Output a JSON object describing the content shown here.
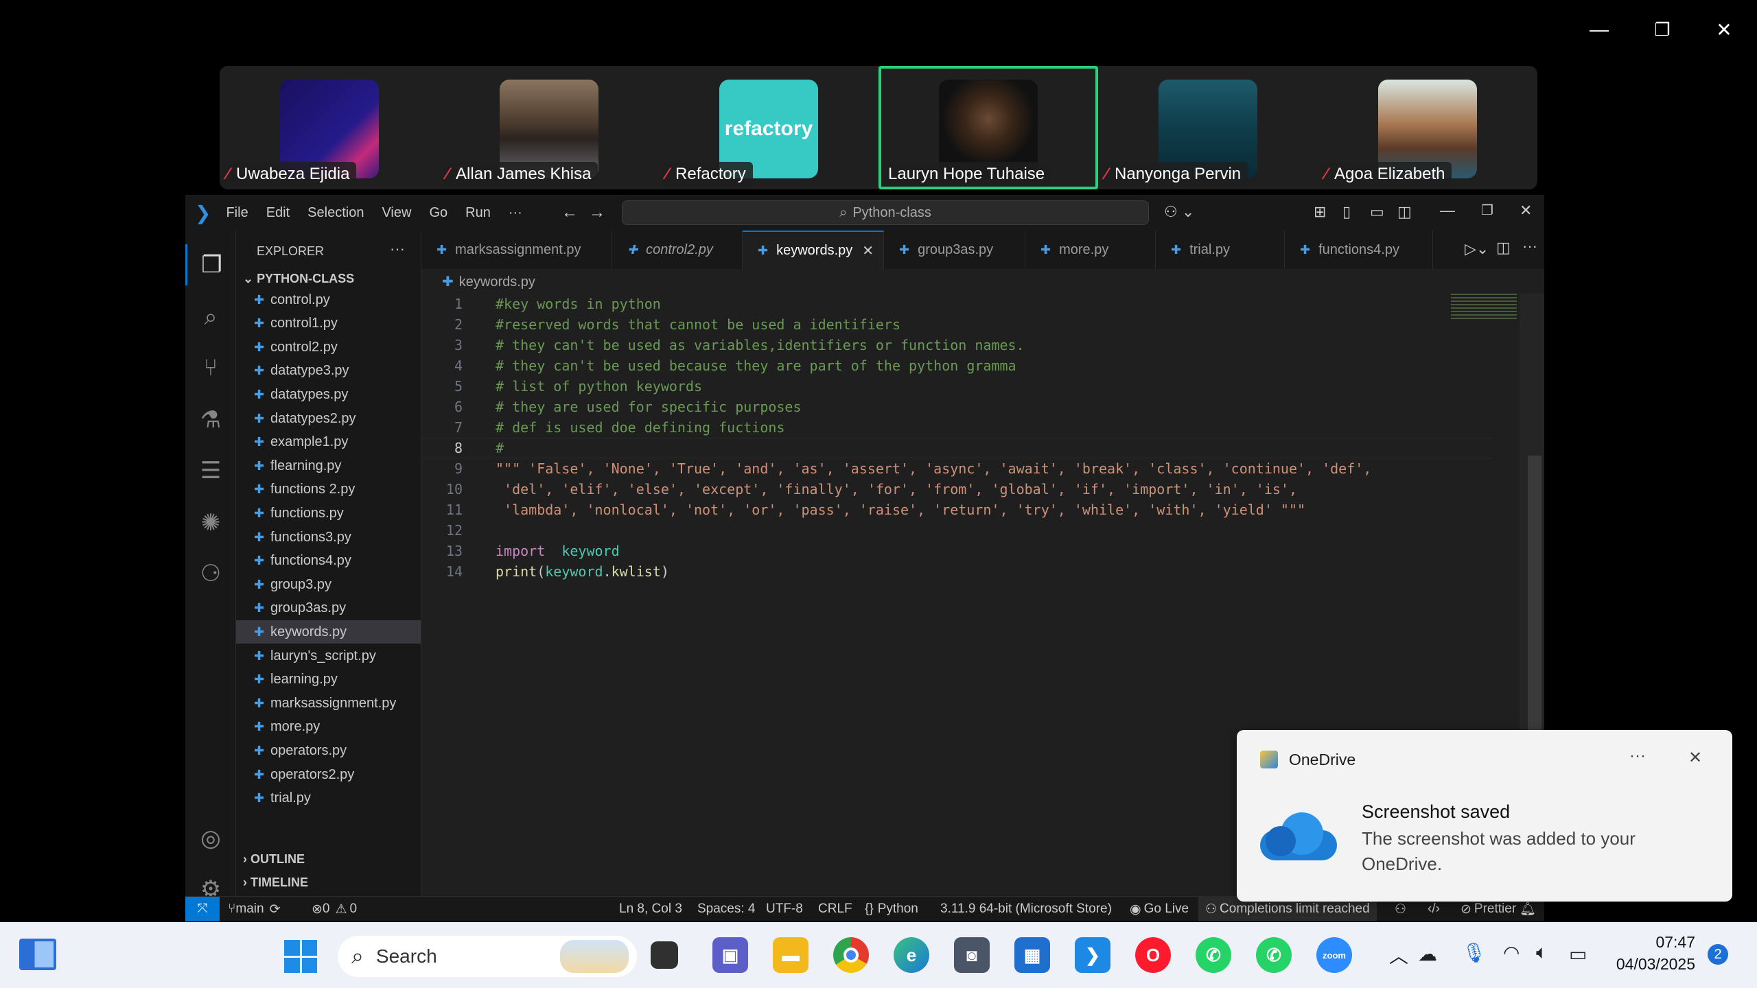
{
  "window_controls": {
    "minimize": "—",
    "restore": "❐",
    "close": "✕"
  },
  "participants": [
    {
      "name": "Uwabeza Ejidia",
      "active": false
    },
    {
      "name": "Allan James Khisa",
      "active": false
    },
    {
      "name": "Refactory",
      "active": false,
      "logo_text": "refactory"
    },
    {
      "name": "Lauryn Hope Tuhaise",
      "active": true
    },
    {
      "name": "Nanyonga Pervin",
      "active": false
    },
    {
      "name": "Agoa Elizabeth",
      "active": false
    }
  ],
  "vscode": {
    "menu": [
      "File",
      "Edit",
      "Selection",
      "View",
      "Go",
      "Run",
      "···"
    ],
    "command_center": "Python-class",
    "explorer_title": "EXPLORER",
    "explorer_more": "···",
    "folder": "PYTHON-CLASS",
    "files": [
      "control.py",
      "control1.py",
      "control2.py",
      "datatype3.py",
      "datatypes.py",
      "datatypes2.py",
      "example1.py",
      "flearning.py",
      "functions 2.py",
      "functions.py",
      "functions3.py",
      "functions4.py",
      "group3.py",
      "group3as.py",
      "keywords.py",
      "lauryn's_script.py",
      "learning.py",
      "marksassignment.py",
      "more.py",
      "operators.py",
      "operators2.py",
      "trial.py"
    ],
    "selected_file": "keywords.py",
    "outline": "OUTLINE",
    "timeline": "TIMELINE",
    "tabs": [
      "marksassignment.py",
      "control2.py",
      "keywords.py",
      "group3as.py",
      "more.py",
      "trial.py",
      "functions4.py"
    ],
    "active_tab": "keywords.py",
    "breadcrumb": "keywords.py",
    "code_lines": [
      {
        "n": "1",
        "text": "#key words in python"
      },
      {
        "n": "2",
        "text": "#reserved words that cannot be used a identifiers"
      },
      {
        "n": "3",
        "text": "# they can't be used as variables,identifiers or function names."
      },
      {
        "n": "4",
        "text": "# they can't be used because they are part of the python gramma"
      },
      {
        "n": "5",
        "text": "# list of python keywords"
      },
      {
        "n": "6",
        "text": "# they are used for specific purposes"
      },
      {
        "n": "7",
        "text": "# def is used doe defining fuctions"
      },
      {
        "n": "8",
        "text": "#"
      },
      {
        "n": "9",
        "text": "\"\"\" 'False', 'None', 'True', 'and', 'as', 'assert', 'async', 'await', 'break', 'class', 'continue', 'def',"
      },
      {
        "n": "10",
        "text": " 'del', 'elif', 'else', 'except', 'finally', 'for', 'from', 'global', 'if', 'import', 'in', 'is',"
      },
      {
        "n": "11",
        "text": " 'lambda', 'nonlocal', 'not', 'or', 'pass', 'raise', 'return', 'try', 'while', 'with', 'yield' \"\"\""
      },
      {
        "n": "12",
        "text": ""
      },
      {
        "n": "13",
        "import_kw": "import",
        "import_mod": "keyword"
      },
      {
        "n": "14",
        "print_fn": "print",
        "print_open": "(",
        "print_obj": "keyword",
        "print_dot": ".",
        "print_attr": "kwlist",
        "print_close": ")"
      }
    ],
    "status": {
      "branch": "main",
      "errors": "0",
      "warnings": "0",
      "position": "Ln 8, Col 3",
      "spaces": "Spaces: 4",
      "encoding": "UTF-8",
      "eol": "CRLF",
      "language": "Python",
      "interpreter": "3.11.9 64-bit (Microsoft Store)",
      "golive": "Go Live",
      "copilot": "Completions limit reached",
      "prettier": "Prettier"
    }
  },
  "toast": {
    "app": "OneDrive",
    "more": "···",
    "title": "Screenshot saved",
    "body": "The screenshot was added to your OneDrive."
  },
  "taskbar": {
    "search_placeholder": "Search",
    "time": "07:47",
    "date": "04/03/2025",
    "notification_count": "2"
  },
  "colors": {
    "vscode_accent": "#0078d4",
    "active_speaker": "#28d27b",
    "comment": "#6a9955",
    "string": "#ce9178",
    "keyword": "#c586c0"
  }
}
